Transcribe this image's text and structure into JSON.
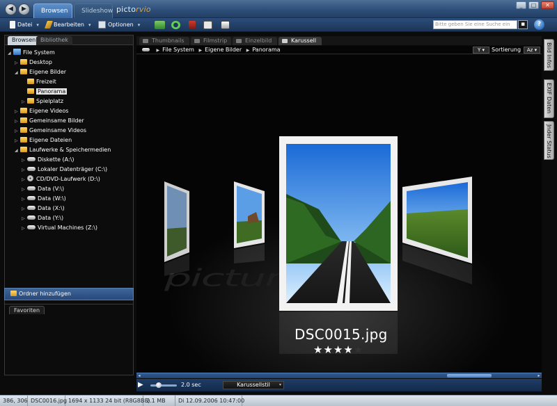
{
  "nav": {
    "back_glyph": "◀",
    "forward_glyph": "▶"
  },
  "tabs": {
    "browsen": "Browsen",
    "slideshow": "Slideshow"
  },
  "logo": {
    "prefix": "picto",
    "suffix": "rvio"
  },
  "window": {
    "minimize_glyph": "_",
    "maximize_glyph": "□",
    "close_glyph": "✕"
  },
  "toolbar": {
    "datei": "Datei",
    "bearbeiten": "Bearbeiten",
    "optionen": "Optionen",
    "dropdown_glyph": "▾",
    "tools": [
      "send-to-icon",
      "rotate-icon",
      "delete-icon",
      "slideshow-icon",
      "print-icon"
    ]
  },
  "search": {
    "placeholder": "Bitte geben Sie eine Suche ein",
    "button_glyph": "▪"
  },
  "help_glyph": "?",
  "left": {
    "tabs": {
      "browsen": "Browsen",
      "bibliothek": "Bibliothek"
    },
    "tree": [
      {
        "label": "File System",
        "icon": "computer-icon",
        "twisty": "◢",
        "level": 0
      },
      {
        "label": "Desktop",
        "icon": "folder-icon",
        "twisty": "▷",
        "level": 1
      },
      {
        "label": "Eigene Bilder",
        "icon": "folder-icon",
        "twisty": "◢",
        "level": 1
      },
      {
        "label": "Freizeit",
        "icon": "folder-icon",
        "twisty": "",
        "level": 2
      },
      {
        "label": "Panorama",
        "icon": "folder-icon",
        "twisty": "",
        "level": 2,
        "selected": true
      },
      {
        "label": "Spielplatz",
        "icon": "folder-icon",
        "twisty": "▷",
        "level": 2
      },
      {
        "label": "Eigene Videos",
        "icon": "folder-icon",
        "twisty": "▷",
        "level": 1
      },
      {
        "label": "Gemeinsame Bilder",
        "icon": "folder-icon",
        "twisty": "▷",
        "level": 1
      },
      {
        "label": "Gemeinsame Videos",
        "icon": "folder-icon",
        "twisty": "▷",
        "level": 1
      },
      {
        "label": "Eigene Dateien",
        "icon": "folder-icon",
        "twisty": "▷",
        "level": 1
      },
      {
        "label": "Laufwerke & Speichermedien",
        "icon": "folder-icon",
        "twisty": "◢",
        "level": 1
      },
      {
        "label": "Diskette (A:\\)",
        "icon": "drive-icon",
        "twisty": "▷",
        "level": 2
      },
      {
        "label": "Lokaler Datenträger (C:\\)",
        "icon": "drive-icon",
        "twisty": "▷",
        "level": 2
      },
      {
        "label": "CD/DVD-Laufwerk (D:\\)",
        "icon": "disc-icon",
        "twisty": "▷",
        "level": 2
      },
      {
        "label": "Data (V:\\)",
        "icon": "drive-icon",
        "twisty": "▷",
        "level": 2
      },
      {
        "label": "Data (W:\\)",
        "icon": "drive-icon",
        "twisty": "▷",
        "level": 2
      },
      {
        "label": "Data (X:\\)",
        "icon": "drive-icon",
        "twisty": "▷",
        "level": 2
      },
      {
        "label": "Data (Y:\\)",
        "icon": "drive-icon",
        "twisty": "▷",
        "level": 2
      },
      {
        "label": "Virtual Machines (Z:\\)",
        "icon": "drive-icon",
        "twisty": "▷",
        "level": 2
      }
    ],
    "add_folder": "Ordner hinzufügen",
    "favoriten": "Favoriten"
  },
  "view": {
    "tabs": [
      "Thumbnails",
      "Filmstrip",
      "Einzelbild",
      "Karussell"
    ],
    "active_tab": "Karussell",
    "breadcrumb": [
      "File System",
      "Eigene Bilder",
      "Panorama"
    ],
    "crumb_sep": "▶",
    "filter_glyph": "Y ▾",
    "sort_label": "Sortierung",
    "sort_order": "Az ▾"
  },
  "side_tabs": [
    "Bild Infos",
    "EXIF Daten",
    "Jnder Status"
  ],
  "carousel": {
    "watermark": "picturmo",
    "filename": "DSC0015.jpg",
    "rating": 4,
    "rating_max": 5,
    "star_on": "★★★★",
    "star_off": "★"
  },
  "scroll": {
    "left_glyph": "◂",
    "right_glyph": "▸"
  },
  "player": {
    "play_glyph": "▶",
    "speed": "2.0 sec",
    "style_select": "Karussellstil",
    "dd_glyph": "▾"
  },
  "status": {
    "coords": "386, 306",
    "file": "DSC0016.jpg",
    "dims": "1694 x 1133 24 bit (R8G8B8)",
    "size": "2.1 MB",
    "date": "Di 12.09.2006 10:47:00"
  },
  "colors": {
    "accent": "#3668a6",
    "toolbar": "#1c3558",
    "background": "#0b0b0b"
  }
}
